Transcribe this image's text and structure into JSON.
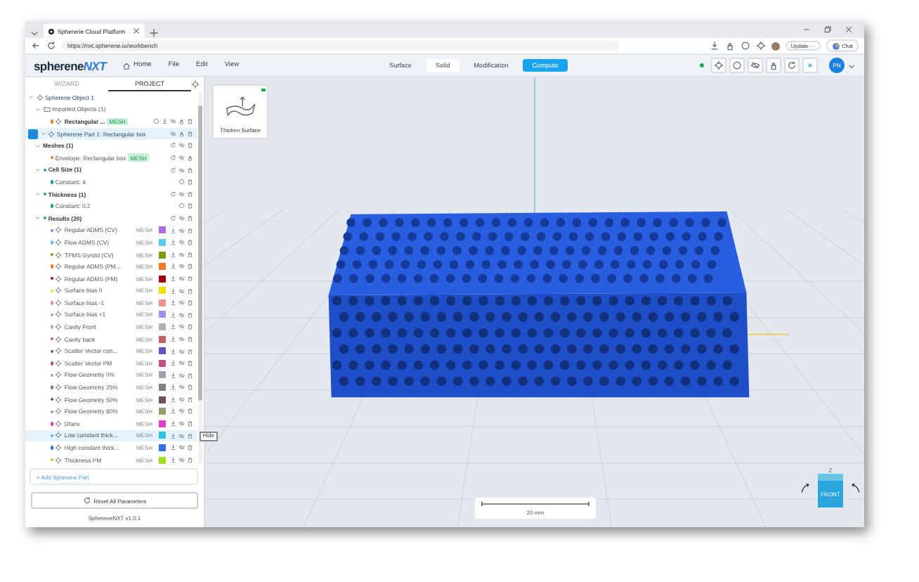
{
  "browser": {
    "tab_title": "Spherene Cloud Platform",
    "url": "https://nxt.spherene.io/workbench",
    "update_label": "Update",
    "update_more": "···",
    "chat_label": "Chat"
  },
  "app": {
    "logo_main": "spherene",
    "logo_accent": "NXT",
    "menu": [
      "Home",
      "File",
      "Edit",
      "View"
    ],
    "mode_tabs": [
      {
        "label": "Surface",
        "selected": false,
        "kind": "tab"
      },
      {
        "label": "Solid",
        "selected": true,
        "kind": "tab"
      },
      {
        "label": "Modification",
        "selected": false,
        "kind": "tab"
      },
      {
        "label": "Compute",
        "kind": "action"
      }
    ],
    "avatar": "PN"
  },
  "panel_tabs": [
    {
      "label": "WIZARD",
      "selected": false
    },
    {
      "label": "PROJECT",
      "selected": true
    }
  ],
  "tree": [
    {
      "kind": "object",
      "label": "Spherene Object 1",
      "expanded": true,
      "children": [
        {
          "kind": "folder",
          "label": "Imported Objects (1)",
          "expanded": true,
          "children": [
            {
              "kind": "imported",
              "label": "Rectangular ...",
              "badge": "MESH",
              "color": "#f07820"
            }
          ]
        }
      ]
    },
    {
      "kind": "part",
      "label": "Spherene Part 1: Rectangular box",
      "checked": true,
      "expanded": true,
      "children": [
        {
          "kind": "group",
          "label": "Meshes (1)",
          "expanded": true,
          "children": [
            {
              "kind": "mesh",
              "label": "Envelope: Rectangular box",
              "badge": "MESH",
              "color": "#f07820"
            }
          ]
        },
        {
          "kind": "group",
          "label": "Cell Size (1)",
          "expanded": true,
          "color": "#20a0a0",
          "children": [
            {
              "kind": "constant",
              "label": "Constant: 4",
              "color": "#20a0a0"
            }
          ]
        },
        {
          "kind": "group",
          "label": "Thickness (1)",
          "expanded": true,
          "color": "#20a0a0",
          "children": [
            {
              "kind": "constant",
              "label": "Constant: 0.2",
              "color": "#20a0a0"
            }
          ]
        },
        {
          "kind": "group",
          "label": "Results (20)",
          "expanded": true,
          "color": "#20b050",
          "children": [
            {
              "kind": "result",
              "label": "Regular ADMS (CV)",
              "tag": "MESH",
              "color": "#b06ae0",
              "selected": false
            },
            {
              "kind": "result",
              "label": "Flow ADMS (CV)",
              "tag": "MESH",
              "color": "#5ec8f0",
              "selected": false
            },
            {
              "kind": "result",
              "label": "TPMS Gyroid (CV)",
              "tag": "MESH",
              "color": "#7a9a10",
              "selected": false
            },
            {
              "kind": "result",
              "label": "Regular ADMS (PM...",
              "tag": "MESH",
              "color": "#f07820",
              "selected": false
            },
            {
              "kind": "result",
              "label": "Regular ADMS (PM)",
              "tag": "MESH",
              "color": "#a00010",
              "selected": false
            },
            {
              "kind": "result",
              "label": "Surface bias 0",
              "tag": "MESH",
              "color": "#f0e000",
              "selected": false
            },
            {
              "kind": "result",
              "label": "Surface bias -1",
              "tag": "MESH",
              "color": "#f09090",
              "selected": false
            },
            {
              "kind": "result",
              "label": "Surface bias +1",
              "tag": "MESH",
              "color": "#a090f0",
              "selected": false
            },
            {
              "kind": "result",
              "label": "Cavity Front",
              "tag": "MESH",
              "color": "#b0b0b8",
              "selected": false
            },
            {
              "kind": "result",
              "label": "Cavity back",
              "tag": "MESH",
              "color": "#c06060",
              "selected": false
            },
            {
              "kind": "result",
              "label": "Scatter Vector con...",
              "tag": "MESH",
              "color": "#6050c0",
              "selected": false
            },
            {
              "kind": "result",
              "label": "Scatter Vector PM",
              "tag": "MESH",
              "color": "#c05080",
              "selected": false
            },
            {
              "kind": "result",
              "label": "Flow Geometry 0%",
              "tag": "MESH",
              "color": "#a0a0a8",
              "selected": false
            },
            {
              "kind": "result",
              "label": "Flow Geometry 25%",
              "tag": "MESH",
              "color": "#808080",
              "selected": false
            },
            {
              "kind": "result",
              "label": "Flow Geometry 50%",
              "tag": "MESH",
              "color": "#705058",
              "selected": false
            },
            {
              "kind": "result",
              "label": "Flow Geometry 80%",
              "tag": "MESH",
              "color": "#90a070",
              "selected": false
            },
            {
              "kind": "result",
              "label": "Dfanv",
              "tag": "MESH",
              "color": "#e040c0",
              "selected": false
            },
            {
              "kind": "result",
              "label": "Low constant thick...",
              "tag": "MESH",
              "color": "#30c0e0",
              "selected": true
            },
            {
              "kind": "result",
              "label": "High constant thick...",
              "tag": "MESH",
              "color": "#3070e0",
              "selected": false
            },
            {
              "kind": "result",
              "label": "Thickness PM",
              "tag": "MESH",
              "color": "#a0e020",
              "selected": false
            }
          ]
        }
      ]
    }
  ],
  "tooltip": "Hide",
  "add_part": "+ Add Spherene Part",
  "reset_button": "Reset All Parameters",
  "version": "SphereneNXT v1.0.1",
  "operation_card": {
    "label": "Thicken Surface",
    "ready": true
  },
  "scale_bar": "20 mm",
  "view_cube": {
    "face": "FRONT",
    "axis_z": "Z"
  }
}
